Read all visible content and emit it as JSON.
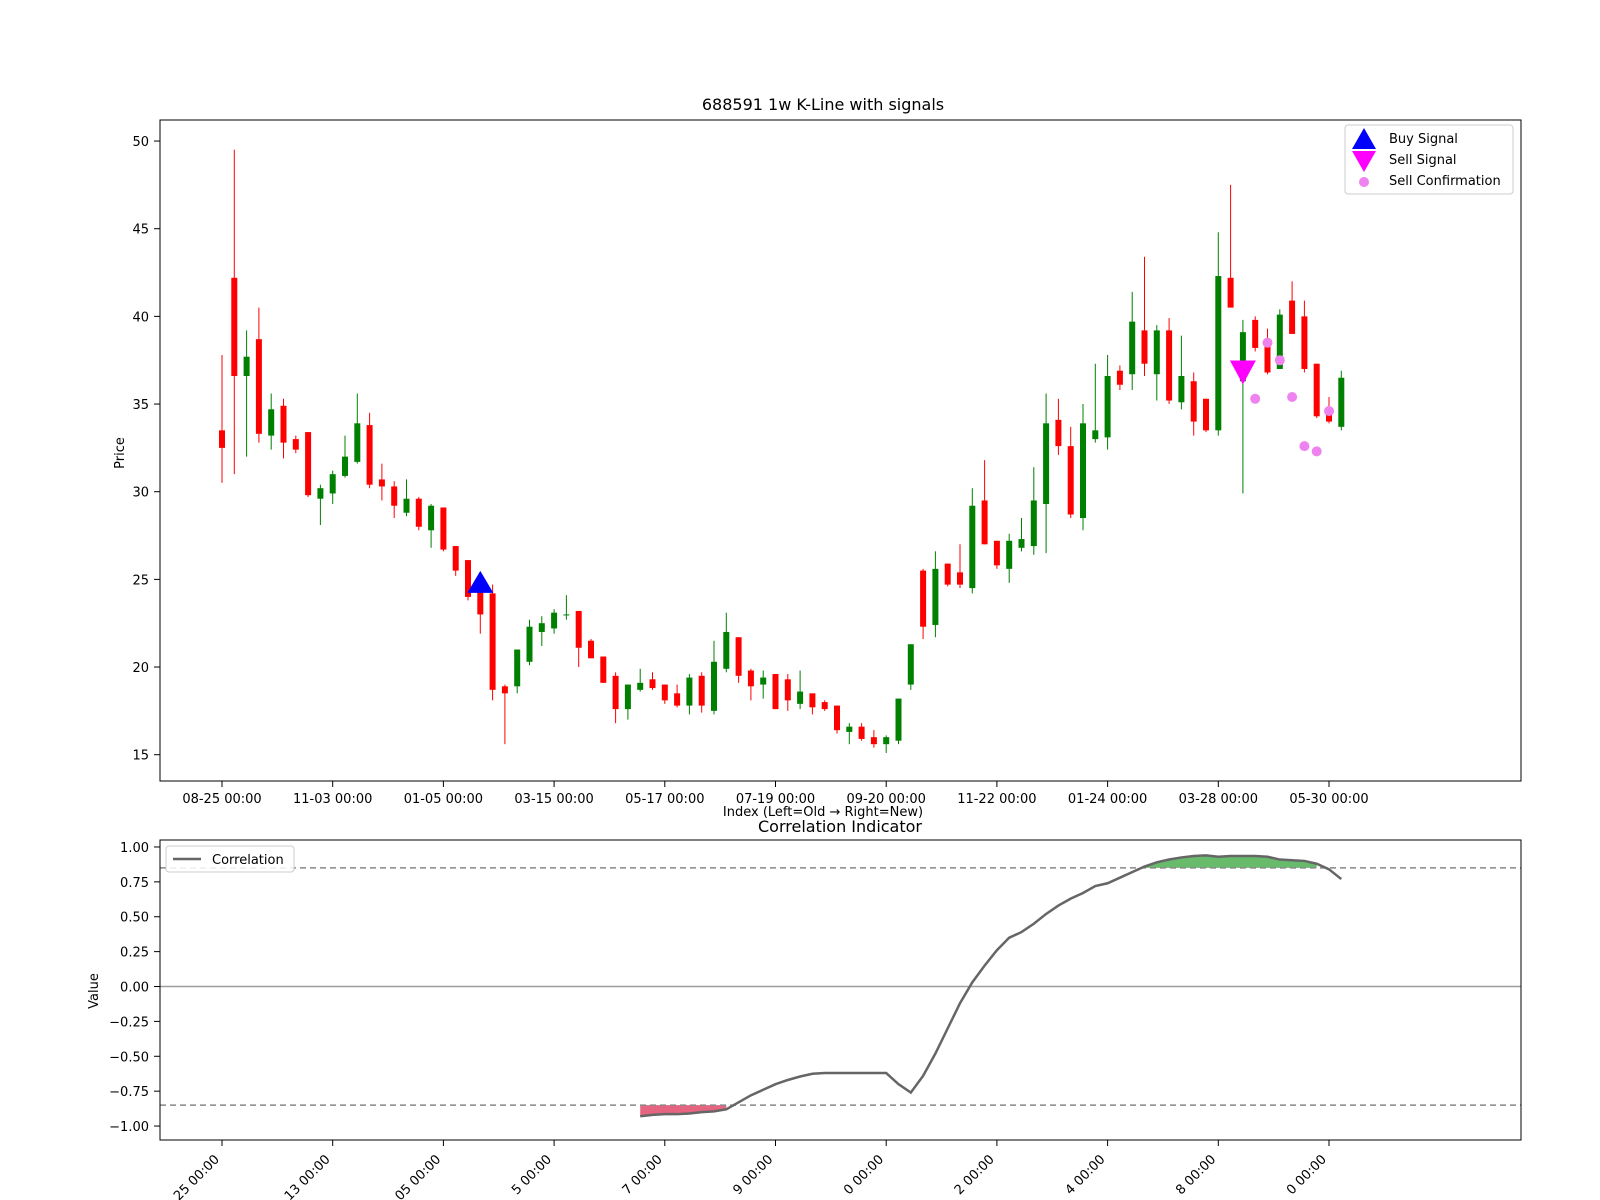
{
  "chart_data": [
    {
      "type": "candlestick",
      "title": "688591 1w K-Line with signals",
      "xlabel": "Index (Left=Old → Right=New)",
      "ylabel": "Price",
      "ylim": [
        13.5,
        51.2
      ],
      "yticks": [
        15,
        20,
        25,
        30,
        35,
        40,
        45,
        50
      ],
      "xtick_labels": [
        {
          "index": 0,
          "label": "08-25 00:00"
        },
        {
          "index": 9,
          "label": "11-03 00:00"
        },
        {
          "index": 18,
          "label": "01-05 00:00"
        },
        {
          "index": 27,
          "label": "03-15 00:00"
        },
        {
          "index": 36,
          "label": "05-17 00:00"
        },
        {
          "index": 45,
          "label": "07-19 00:00"
        },
        {
          "index": 54,
          "label": "09-20 00:00"
        },
        {
          "index": 63,
          "label": "11-22 00:00"
        },
        {
          "index": 72,
          "label": "01-24 00:00"
        },
        {
          "index": 81,
          "label": "03-28 00:00"
        },
        {
          "index": 90,
          "label": "05-30 00:00"
        }
      ],
      "up_color": "#008000",
      "down_color": "#ff0000",
      "ohlc": [
        [
          33.5,
          37.8,
          30.5,
          32.5
        ],
        [
          42.2,
          49.5,
          31.0,
          36.6
        ],
        [
          36.6,
          39.2,
          32.0,
          37.7
        ],
        [
          38.7,
          40.5,
          32.8,
          33.3
        ],
        [
          33.2,
          35.6,
          32.4,
          34.7
        ],
        [
          34.9,
          35.3,
          31.9,
          32.8
        ],
        [
          33.0,
          33.2,
          32.2,
          32.4
        ],
        [
          33.4,
          33.4,
          29.7,
          29.8
        ],
        [
          29.6,
          30.4,
          28.1,
          30.2
        ],
        [
          29.9,
          31.2,
          29.3,
          31.0
        ],
        [
          30.9,
          33.2,
          30.8,
          32.0
        ],
        [
          31.7,
          35.6,
          31.6,
          33.9
        ],
        [
          33.8,
          34.5,
          30.2,
          30.4
        ],
        [
          30.7,
          31.6,
          29.5,
          30.3
        ],
        [
          30.3,
          30.6,
          28.5,
          29.2
        ],
        [
          28.8,
          30.7,
          28.6,
          29.6
        ],
        [
          29.6,
          29.7,
          27.8,
          28.0
        ],
        [
          27.8,
          29.3,
          26.8,
          29.2
        ],
        [
          29.1,
          29.1,
          26.6,
          26.7
        ],
        [
          26.9,
          26.9,
          25.2,
          25.5
        ],
        [
          26.1,
          26.1,
          23.8,
          24.0
        ],
        [
          24.4,
          24.7,
          21.9,
          23.0
        ],
        [
          24.2,
          24.7,
          18.1,
          18.7
        ],
        [
          18.9,
          19.0,
          15.6,
          18.5
        ],
        [
          18.9,
          21.0,
          18.5,
          21.0
        ],
        [
          20.3,
          22.7,
          20.1,
          22.3
        ],
        [
          22.0,
          22.9,
          21.2,
          22.5
        ],
        [
          22.2,
          23.3,
          21.9,
          23.1
        ],
        [
          23.0,
          24.1,
          22.7,
          23.0
        ],
        [
          23.2,
          23.2,
          20.0,
          21.1
        ],
        [
          21.5,
          21.6,
          20.5,
          20.5
        ],
        [
          20.6,
          20.6,
          19.1,
          19.1
        ],
        [
          19.5,
          19.7,
          16.8,
          17.6
        ],
        [
          17.6,
          19.0,
          17.0,
          19.0
        ],
        [
          18.7,
          19.9,
          18.6,
          19.1
        ],
        [
          19.3,
          19.7,
          18.7,
          18.8
        ],
        [
          19.0,
          19.0,
          17.9,
          18.1
        ],
        [
          18.5,
          19.0,
          17.7,
          17.8
        ],
        [
          17.8,
          19.6,
          17.3,
          19.4
        ],
        [
          19.5,
          19.7,
          17.4,
          17.8
        ],
        [
          17.5,
          21.5,
          17.3,
          20.3
        ],
        [
          19.9,
          23.1,
          19.7,
          22.0
        ],
        [
          21.7,
          21.7,
          19.1,
          19.5
        ],
        [
          19.8,
          19.9,
          18.1,
          18.9
        ],
        [
          19.0,
          19.8,
          18.2,
          19.4
        ],
        [
          19.6,
          19.6,
          17.6,
          17.6
        ],
        [
          19.3,
          19.6,
          17.5,
          18.1
        ],
        [
          17.9,
          19.8,
          17.6,
          18.6
        ],
        [
          18.5,
          18.5,
          17.3,
          17.7
        ],
        [
          18.0,
          18.1,
          17.5,
          17.6
        ],
        [
          17.8,
          17.8,
          16.2,
          16.4
        ],
        [
          16.3,
          16.8,
          15.6,
          16.6
        ],
        [
          16.6,
          16.8,
          15.8,
          15.9
        ],
        [
          16.0,
          16.4,
          15.4,
          15.6
        ],
        [
          15.6,
          16.1,
          15.1,
          16.0
        ],
        [
          15.8,
          18.2,
          15.6,
          18.2
        ],
        [
          19.0,
          21.3,
          18.7,
          21.3
        ],
        [
          25.5,
          25.6,
          21.6,
          22.3
        ],
        [
          22.4,
          26.6,
          21.7,
          25.6
        ],
        [
          25.9,
          25.9,
          24.6,
          24.7
        ],
        [
          25.4,
          27.0,
          24.5,
          24.7
        ],
        [
          24.5,
          30.2,
          24.2,
          29.2
        ],
        [
          29.5,
          31.8,
          27.0,
          27.0
        ],
        [
          27.2,
          27.2,
          25.6,
          25.8
        ],
        [
          25.6,
          27.6,
          24.8,
          27.2
        ],
        [
          26.8,
          28.5,
          26.6,
          27.3
        ],
        [
          26.9,
          31.4,
          26.4,
          29.5
        ],
        [
          29.3,
          35.6,
          26.5,
          33.9
        ],
        [
          34.1,
          35.3,
          32.1,
          32.6
        ],
        [
          32.6,
          33.7,
          28.5,
          28.7
        ],
        [
          28.5,
          35.0,
          27.8,
          33.9
        ],
        [
          33.0,
          37.3,
          32.8,
          33.5
        ],
        [
          33.1,
          37.8,
          32.4,
          36.6
        ],
        [
          36.9,
          37.2,
          35.8,
          36.1
        ],
        [
          36.7,
          41.4,
          35.8,
          39.7
        ],
        [
          39.2,
          43.4,
          36.6,
          37.3
        ],
        [
          36.7,
          39.5,
          35.2,
          39.2
        ],
        [
          39.2,
          39.9,
          35.0,
          35.2
        ],
        [
          35.1,
          38.9,
          34.7,
          36.6
        ],
        [
          36.3,
          36.8,
          33.2,
          34.0
        ],
        [
          35.3,
          35.3,
          33.4,
          33.5
        ],
        [
          33.5,
          44.8,
          33.2,
          42.3
        ],
        [
          42.2,
          47.5,
          40.5,
          40.5
        ],
        [
          36.3,
          39.8,
          29.9,
          39.1
        ],
        [
          39.8,
          40.0,
          38.0,
          38.2
        ],
        [
          38.4,
          39.3,
          36.7,
          36.8
        ],
        [
          37.0,
          40.4,
          37.0,
          40.1
        ],
        [
          40.9,
          42.0,
          39.0,
          39.0
        ],
        [
          40.0,
          40.9,
          36.8,
          37.0
        ],
        [
          37.3,
          37.3,
          34.2,
          34.3
        ],
        [
          34.6,
          35.4,
          33.9,
          34.0
        ],
        [
          33.7,
          36.9,
          33.5,
          36.5
        ]
      ],
      "buy_signals": [
        {
          "index": 21,
          "price": 24.8
        }
      ],
      "sell_signals": [
        {
          "index": 83,
          "price": 36.8
        }
      ],
      "sell_confirmations": [
        {
          "index": 84,
          "price": 35.3
        },
        {
          "index": 85,
          "price": 38.5
        },
        {
          "index": 86,
          "price": 37.5
        },
        {
          "index": 87,
          "price": 35.4
        },
        {
          "index": 88,
          "price": 32.6
        },
        {
          "index": 89,
          "price": 32.3
        },
        {
          "index": 90,
          "price": 34.6
        }
      ],
      "legend": {
        "placement": "top-right",
        "entries": [
          {
            "label": "Buy Signal",
            "color": "#0000ff",
            "marker": "triangle-up"
          },
          {
            "label": "Sell Signal",
            "color": "#ff00ff",
            "marker": "triangle-down"
          },
          {
            "label": "Sell Confirmation",
            "color": "#ee82ee",
            "marker": "circle"
          }
        ]
      }
    },
    {
      "type": "line",
      "title": "Correlation Indicator",
      "ylabel": "Value",
      "ylim": [
        -1.1,
        1.05
      ],
      "yticks": [
        1.0,
        0.75,
        0.5,
        0.25,
        0.0,
        -0.25,
        -0.5,
        -0.75,
        -1.0
      ],
      "ytick_labels": [
        "1.00",
        "0.75",
        "0.50",
        "0.25",
        "0.00",
        "−0.25",
        "−0.50",
        "−0.75",
        "−1.00"
      ],
      "xtick_labels": [
        {
          "index": 0,
          "label": "25 00:00"
        },
        {
          "index": 9,
          "label": "13 00:00"
        },
        {
          "index": 18,
          "label": "05 00:00"
        },
        {
          "index": 27,
          "label": "5 00:00"
        },
        {
          "index": 36,
          "label": "7 00:00"
        },
        {
          "index": 45,
          "label": "9 00:00"
        },
        {
          "index": 54,
          "label": "0 00:00"
        },
        {
          "index": 63,
          "label": "2 00:00"
        },
        {
          "index": 72,
          "label": "4 00:00"
        },
        {
          "index": 81,
          "label": "8 00:00"
        },
        {
          "index": 90,
          "label": "0 00:00"
        }
      ],
      "thresholds": [
        0.85,
        -0.85
      ],
      "upper_fill_color": "#4caf50",
      "lower_fill_color": "#e04a6a",
      "line_color": "#666666",
      "series": [
        {
          "name": "Correlation",
          "start_index": 34,
          "values": [
            -0.93,
            -0.92,
            -0.915,
            -0.915,
            -0.91,
            -0.9,
            -0.895,
            -0.88,
            -0.83,
            -0.78,
            -0.74,
            -0.7,
            -0.67,
            -0.645,
            -0.625,
            -0.62,
            -0.62,
            -0.62,
            -0.62,
            -0.62,
            -0.62,
            -0.7,
            -0.76,
            -0.64,
            -0.48,
            -0.3,
            -0.12,
            0.03,
            0.15,
            0.26,
            0.35,
            0.39,
            0.45,
            0.52,
            0.58,
            0.63,
            0.67,
            0.72,
            0.74,
            0.78,
            0.82,
            0.86,
            0.89,
            0.91,
            0.925,
            0.935,
            0.94,
            0.93,
            0.935,
            0.935,
            0.935,
            0.93,
            0.91,
            0.905,
            0.9,
            0.88,
            0.84,
            0.77
          ]
        }
      ],
      "legend": {
        "placement": "top-left",
        "entries": [
          {
            "label": "Correlation"
          }
        ]
      }
    }
  ]
}
